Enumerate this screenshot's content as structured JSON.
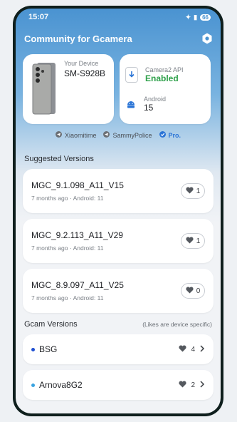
{
  "status": {
    "time": "15:07",
    "battery": "66"
  },
  "app": {
    "title": "Community for Gcamera"
  },
  "device": {
    "label": "Your Device",
    "model": "SM-S928B"
  },
  "api": {
    "camera2_label": "Camera2 API",
    "camera2_value": "Enabled",
    "android_label": "Android",
    "android_value": "15"
  },
  "credits": {
    "xiaomitime": "Xiaomitime",
    "sammypolice": "SammyPolice",
    "pro": "Pro."
  },
  "suggested": {
    "title": "Suggested Versions",
    "items": [
      {
        "name": "MGC_9.1.098_A11_V15",
        "meta": "7 months ago · Android: 11",
        "likes": "1"
      },
      {
        "name": "MGC_9.2.113_A11_V29",
        "meta": "7 months ago · Android: 11",
        "likes": "1"
      },
      {
        "name": "MGC_8.9.097_A11_V25",
        "meta": "7 months ago · Android: 11",
        "likes": "0"
      }
    ]
  },
  "gcam": {
    "title": "Gcam Versions",
    "note": "(Likes are device specific)",
    "items": [
      {
        "name": "BSG",
        "likes": "4",
        "dot_color": "#1f4fd1"
      },
      {
        "name": "Arnova8G2",
        "likes": "2",
        "dot_color": "#3aa3e0"
      }
    ]
  },
  "colors": {
    "accent": "#4a93d1",
    "green": "#2ea04a",
    "pro_blue": "#2a74d6"
  }
}
